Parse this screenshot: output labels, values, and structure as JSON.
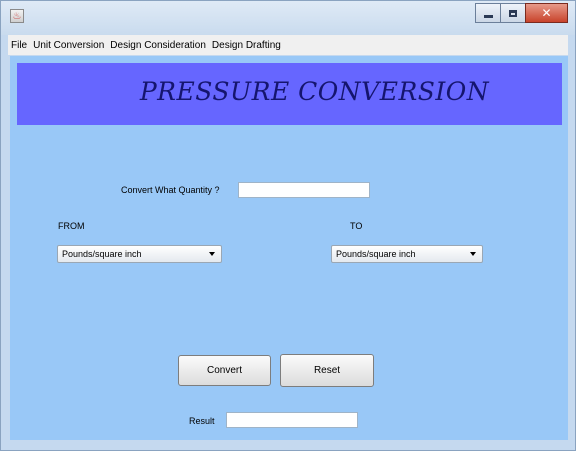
{
  "window": {
    "minimize_symbol": "—",
    "close_symbol": "✕"
  },
  "menu": [
    "File",
    "Unit Conversion",
    "Design Consideration",
    "Design Drafting"
  ],
  "banner": {
    "title": "PRESSURE  CONVERSION"
  },
  "form": {
    "quantity_label": "Convert What Quantity ?",
    "quantity_value": "",
    "from_label": "FROM",
    "to_label": "TO",
    "from_selected": "Pounds/square inch",
    "to_selected": "Pounds/square inch",
    "convert_label": "Convert",
    "reset_label": "Reset",
    "result_label": "Result",
    "result_value": ""
  }
}
